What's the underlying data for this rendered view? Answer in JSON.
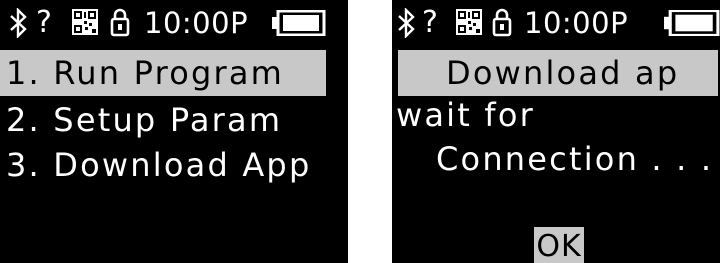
{
  "status_bar": {
    "bluetooth_icon": "bluetooth-icon",
    "unknown_label": "?",
    "qr_icon": "qr-code-icon",
    "lock_icon": "padlock-icon",
    "time": "10:00P",
    "battery_icon": "battery-full-icon"
  },
  "left_screen": {
    "menu": [
      {
        "label": "1. Run Program",
        "selected": true
      },
      {
        "label": "2. Setup Param",
        "selected": false
      },
      {
        "label": "3. Download App",
        "selected": false
      }
    ]
  },
  "right_screen": {
    "header": "Download ap",
    "line1": "wait for",
    "line2": "Connection . . .",
    "ok_label": "OK"
  },
  "colors": {
    "background": "#000000",
    "foreground": "#ffffff",
    "highlight": "#c8c8c8"
  }
}
